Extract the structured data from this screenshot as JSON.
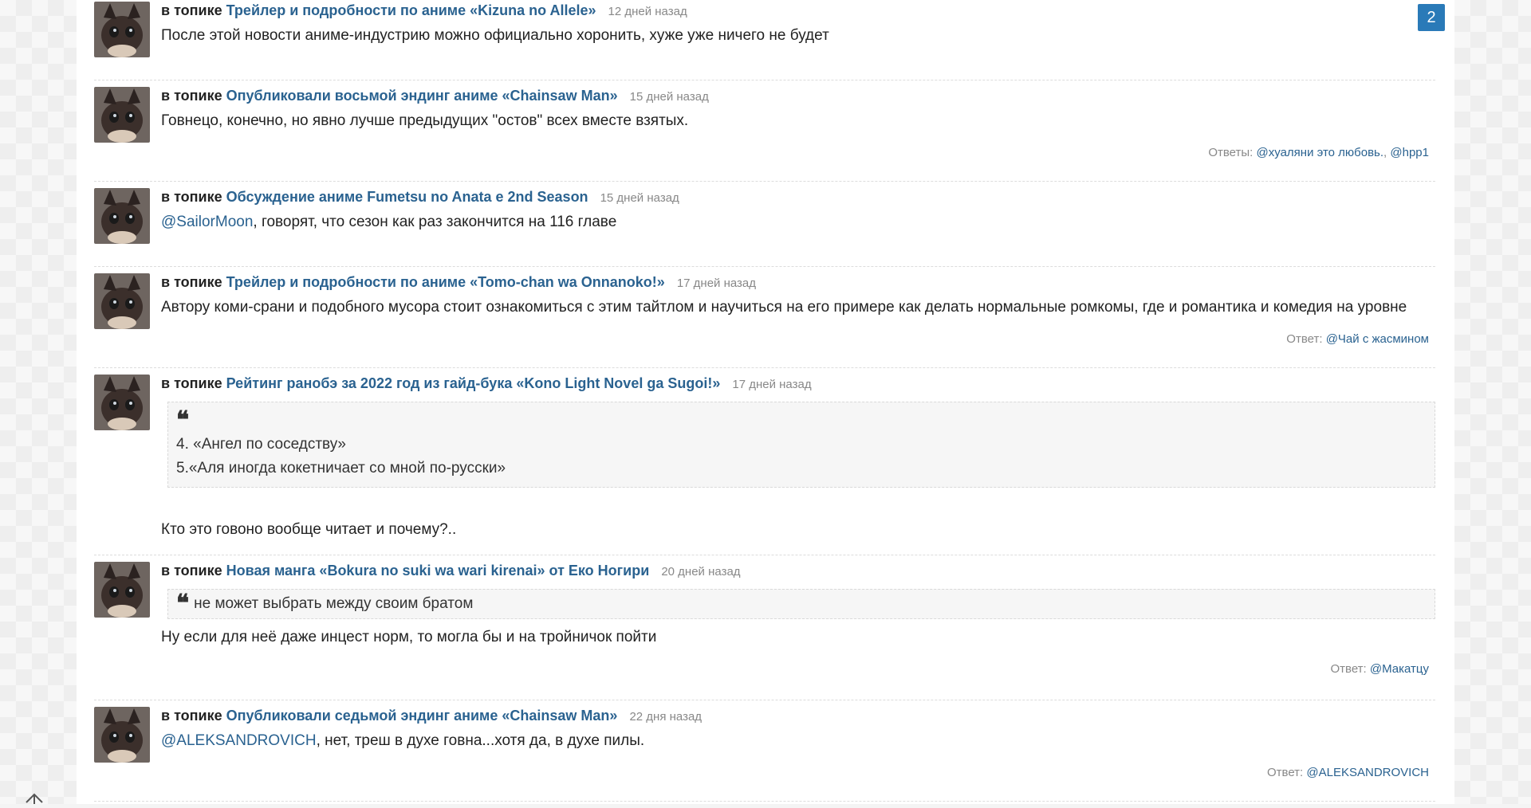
{
  "pagination": {
    "current": "2"
  },
  "comments": [
    {
      "prefix": "в топике",
      "topic": "Трейлер и подробности по аниме «Kizuna no Allele»",
      "time": "12 дней назад",
      "mention": "",
      "text": "После этой новости аниме-индустрию можно официально хоронить, хуже уже ничего не будет"
    },
    {
      "prefix": "в топике",
      "topic": "Опубликовали восьмой эндинг аниме «Chainsaw Man»",
      "time": "15 дней назад",
      "mention": "",
      "text": "Говнецо, конечно, но явно лучше предыдущих \"остов\" всех вместе взятых.",
      "replies_label": "Ответы:",
      "replies": [
        "@хуаляни это любовь.",
        "@hpp1"
      ]
    },
    {
      "prefix": "в топике",
      "topic": "Обсуждение аниме Fumetsu no Anata e 2nd Season",
      "time": "15 дней назад",
      "mention": "@SailorMoon",
      "text": ", говорят, что сезон как раз закончится на 116 главе"
    },
    {
      "prefix": "в топике",
      "topic": "Трейлер и подробности по аниме «Tomo-chan wa Onnanoko!»",
      "time": "17 дней назад",
      "mention": "",
      "text": "Автору коми-срани и подобного мусора стоит ознакомиться с этим тайтлом и научиться на его примере как делать нормальные ромкомы, где и романтика и комедия на уровне",
      "replies_label": "Ответ:",
      "replies": [
        "@Чай с жасмином"
      ]
    },
    {
      "prefix": "в топике",
      "topic": "Рейтинг ранобэ за 2022 год из гайд-бука «Kono Light Novel ga Sugoi!»",
      "time": "17 дней назад",
      "quote_lines": [
        "4. «Ангел по соседству»",
        "5.«Аля иногда кокетничает со мной по-русски»"
      ],
      "text": "Кто это говоно вообще читает и почему?.."
    },
    {
      "prefix": "в топике",
      "topic": "Новая манга «Bokura no suki wa wari kirenai» от Еко Ногири",
      "time": "20 дней назад",
      "quote_inline": "не может выбрать между своим братом",
      "text": "Ну если для неё даже инцест норм, то могла бы и на тройничок пойти",
      "replies_label": "Ответ:",
      "replies": [
        "@Макатцу"
      ]
    },
    {
      "prefix": "в топике",
      "topic": "Опубликовали седьмой эндинг аниме «Chainsaw Man»",
      "time": "22 дня назад",
      "mention": "@ALEKSANDROVICH",
      "text": ", нет, треш в духе говна...хотя да, в духе пилы.",
      "replies_label": "Ответ:",
      "replies": [
        "@ALEKSANDROVICH"
      ]
    }
  ],
  "icons": {
    "avatar": "cat-avatar-icon",
    "quote": "quote-icon",
    "scroll_up": "arrow-up-icon"
  },
  "colors": {
    "link": "#2a6290",
    "badge": "#2a7ab8"
  }
}
